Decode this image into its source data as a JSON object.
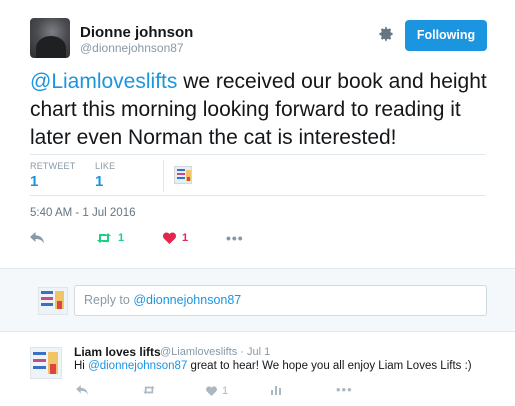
{
  "tweet": {
    "author_name": "Dionne johnson",
    "author_handle": "@dionnejohnson87",
    "follow_label": "Following",
    "text_mention": "@Liamloveslifts",
    "text_body": " we received our book and height chart this morning looking forward to reading it later even Norman the cat is interested!",
    "retweet_label": "RETWEET",
    "retweet_count": "1",
    "like_label": "LIKE",
    "like_count": "1",
    "timestamp": "5:40 AM - 1 Jul 2016",
    "action_retweet_count": "1",
    "action_like_count": "1",
    "icons": {
      "settings": "gear-icon",
      "reply": "reply-icon",
      "retweet": "retweet-icon",
      "like": "heart-icon",
      "more": "more-icon"
    }
  },
  "reply_composer": {
    "prefix": "Reply to ",
    "mention": "@dionnejohnson87"
  },
  "reply_tweet": {
    "author_name": "Liam loves lifts",
    "meta": "@Liamloveslifts · Jul 1",
    "text_prefix": "Hi ",
    "text_mention": "@dionnejohnson87",
    "text_body": " great to hear! We hope you all enjoy Liam Loves Lifts :)",
    "like_count": "1"
  },
  "colors": {
    "accent": "#1b95e0",
    "retweet": "#19cf86",
    "like": "#e2264d",
    "muted": "#8899a6"
  }
}
